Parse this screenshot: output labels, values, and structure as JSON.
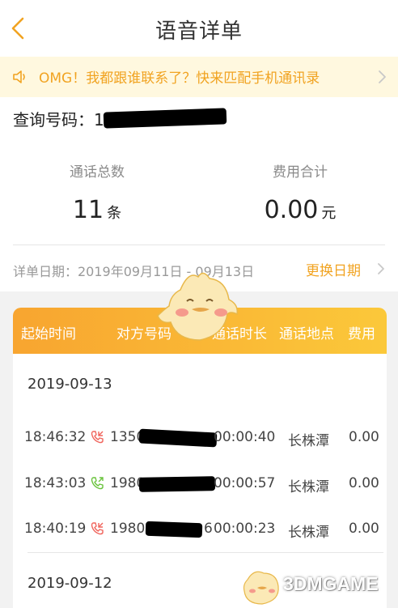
{
  "header": {
    "title": "语音详单",
    "back_icon": "chevron-left-icon"
  },
  "banner": {
    "icon": "speaker-icon",
    "text": "OMG！我都跟谁联系了？快来匹配手机通讯录",
    "chevron_icon": "chevron-right-icon"
  },
  "summary": {
    "query_label": "查询号码：",
    "query_prefix": "1",
    "total_calls_label": "通话总数",
    "total_calls_value": "11",
    "total_calls_unit": "条",
    "total_fee_label": "费用合计",
    "total_fee_value": "0.00",
    "total_fee_unit": "元",
    "date_range": "详单日期：2019年09月11日 - 09月13日",
    "change_date_label": "更换日期"
  },
  "table": {
    "headers": [
      "起始时间",
      "对方号码",
      "通话时长",
      "通话地点",
      "费用"
    ],
    "groups": [
      {
        "date": "2019-09-13",
        "rows": [
          {
            "time": "18:46:32",
            "number_prefix": "1350",
            "duration": "00:00:40",
            "location": "长株潭",
            "fee": "0.00",
            "direction_color": "#f0645c",
            "icon": "incoming-call-icon"
          },
          {
            "time": "18:43:03",
            "number_prefix": "1980",
            "duration": "00:00:57",
            "location": "长株潭",
            "fee": "0.00",
            "direction_color": "#69c33c",
            "icon": "outgoing-call-icon"
          },
          {
            "time": "18:40:19",
            "number_prefix": "1980",
            "number_suffix": "6",
            "duration": "00:00:23",
            "location": "长株潭",
            "fee": "0.00",
            "direction_color": "#f0645c",
            "icon": "incoming-call-icon"
          }
        ]
      },
      {
        "date": "2019-09-12",
        "rows": []
      }
    ]
  },
  "watermark": {
    "text": "3DMGAME"
  },
  "colors": {
    "accent": "#f1a321",
    "banner_bg": "#fff8df",
    "header_gradient_start": "#f8a530",
    "header_gradient_end": "#fbc83a"
  }
}
